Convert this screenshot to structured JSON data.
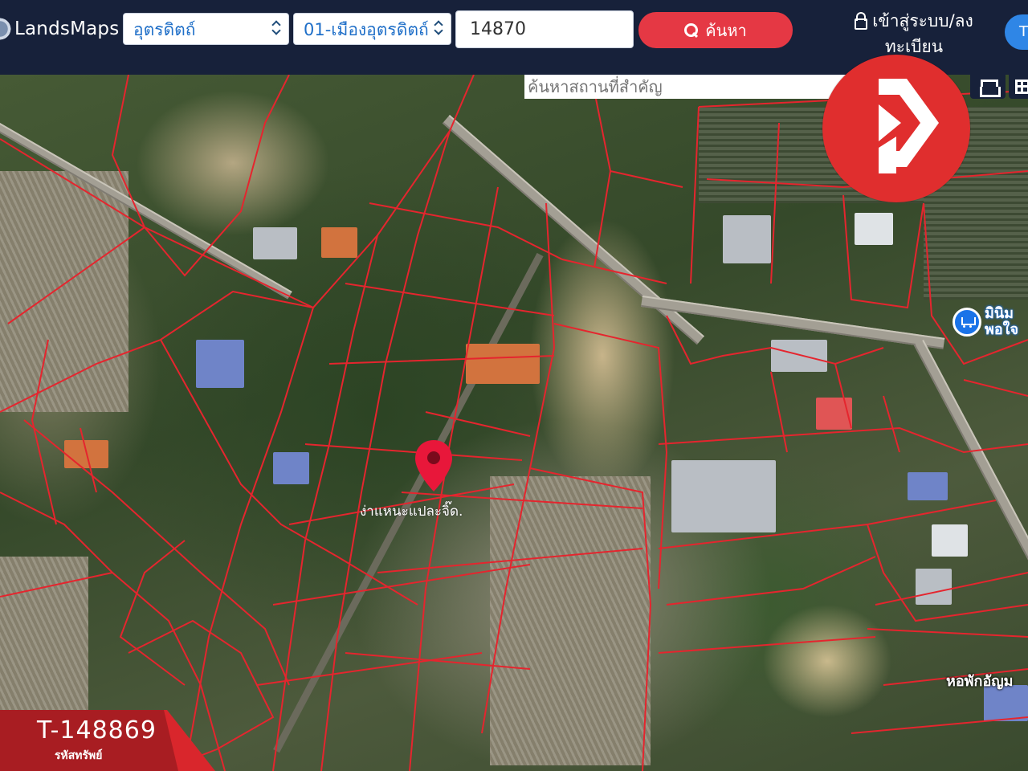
{
  "header": {
    "logo_text": "LandsMaps",
    "province_select": "อุตรดิตถ์",
    "district_select": "01-เมืองอุตรดิตถ์",
    "postcode_value": "14870",
    "search_button": "ค้นหา",
    "login_line1": "เข้าสู่ระบบ/ลง",
    "login_line2": "ทะเบียน",
    "user_initial": "T"
  },
  "map": {
    "place_search_placeholder": "ค้นหาสถานที่สำคัญ",
    "clear_glyph": "×",
    "poi_label": "มินิม พอใจ",
    "parcel_label": "ง่าแหนะแปละจิ๊ด.",
    "bottom_label": "หอพักอัญม"
  },
  "listing": {
    "code": "T-148869",
    "caption": "รหัสทรัพย์"
  },
  "colors": {
    "header_bg": "#17213a",
    "search_button": "#e53844",
    "parcel_lines": "#e5252e",
    "brand_circle": "#e02e2e",
    "code_tag": "#d9262c"
  },
  "icons": {
    "search": "magnifier-icon",
    "login": "lock-icon",
    "home": "home-icon",
    "layers": "grid-icon",
    "poi": "shopping-cart-icon",
    "pin": "map-pin-icon"
  }
}
